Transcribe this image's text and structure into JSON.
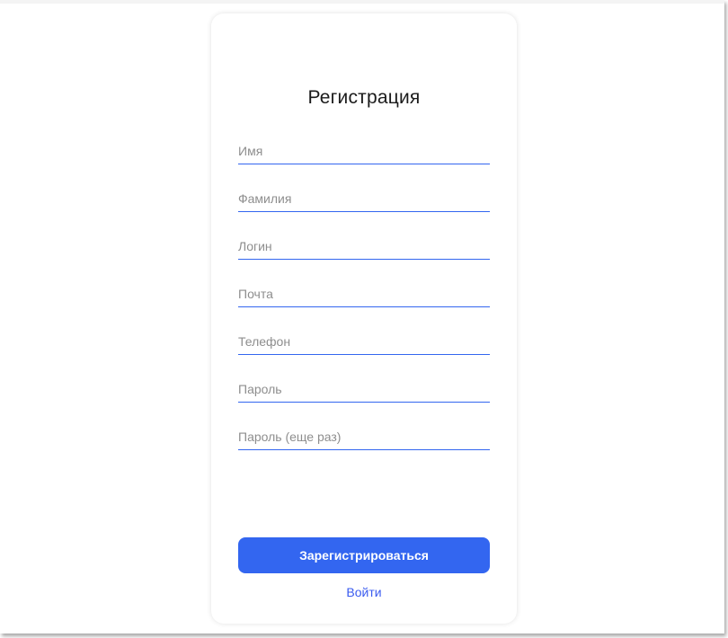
{
  "form": {
    "title": "Регистрация",
    "fields": [
      {
        "placeholder": "Имя",
        "value": ""
      },
      {
        "placeholder": "Фамилия",
        "value": ""
      },
      {
        "placeholder": "Логин",
        "value": ""
      },
      {
        "placeholder": "Почта",
        "value": ""
      },
      {
        "placeholder": "Телефон",
        "value": ""
      },
      {
        "placeholder": "Пароль",
        "value": ""
      },
      {
        "placeholder": "Пароль (еще раз)",
        "value": ""
      }
    ],
    "submit_label": "Зарегистрироваться",
    "login_link": "Войти"
  },
  "colors": {
    "accent": "#3366f0"
  }
}
